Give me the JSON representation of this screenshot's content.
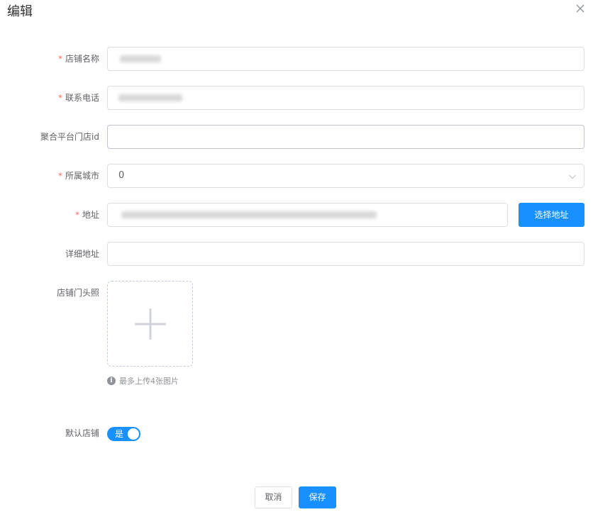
{
  "dialog": {
    "title": "编辑",
    "close_icon": "close-icon"
  },
  "form": {
    "store_name": {
      "label": "店铺名称",
      "required": true,
      "value": ""
    },
    "phone": {
      "label": "联系电话",
      "required": true,
      "value": ""
    },
    "platform_store_id": {
      "label": "聚合平台门店id",
      "required": false,
      "value": ""
    },
    "city": {
      "label": "所属城市",
      "required": true,
      "value": "0",
      "arrow_icon": "chevron-down-icon"
    },
    "address": {
      "label": "地址",
      "required": true,
      "value": "",
      "select_button": "选择地址"
    },
    "detail_address": {
      "label": "详细地址",
      "required": false,
      "value": ""
    },
    "storefront_photo": {
      "label": "店铺门头照",
      "upload_icon": "plus-icon",
      "tip": "最多上传4张图片",
      "tip_icon": "info-icon",
      "max_images": 4
    },
    "default_store": {
      "label": "默认店铺",
      "switch_text": "是",
      "checked": true
    }
  },
  "footer": {
    "cancel_label": "取消",
    "save_label": "保存"
  },
  "colors": {
    "primary": "#1890ff",
    "required": "#f56c6c",
    "border": "#dcdfe6"
  },
  "required_mark": "*"
}
